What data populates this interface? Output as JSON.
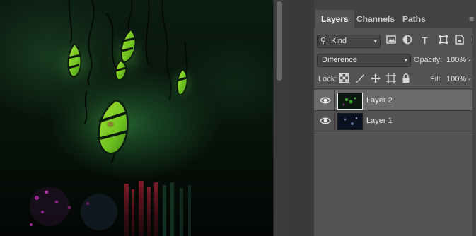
{
  "panel": {
    "tabs": [
      {
        "label": "Layers",
        "active": true
      },
      {
        "label": "Channels",
        "active": false
      },
      {
        "label": "Paths",
        "active": false
      }
    ],
    "menu_icon": "panel-menu-icon"
  },
  "filter": {
    "kind_label": "Kind",
    "icons": [
      "image-filter-icon",
      "adjustment-filter-icon",
      "type-filter-icon",
      "shape-filter-icon",
      "smart-object-filter-icon"
    ]
  },
  "blend": {
    "mode": "Difference",
    "opacity_label": "Opacity:",
    "opacity_value": "100%"
  },
  "lock": {
    "label": "Lock:",
    "icons": [
      "lock-transparency-icon",
      "lock-image-icon",
      "lock-position-icon",
      "lock-artboard-icon",
      "lock-all-icon"
    ],
    "fill_label": "Fill:",
    "fill_value": "100%"
  },
  "layers": [
    {
      "name": "Layer 2",
      "visible": true,
      "selected": true
    },
    {
      "name": "Layer 1",
      "visible": true,
      "selected": false
    }
  ],
  "colors": {
    "panel_bg": "#535353",
    "selected_row": "#6b6b6b",
    "leaf_green": "#7ed321"
  }
}
